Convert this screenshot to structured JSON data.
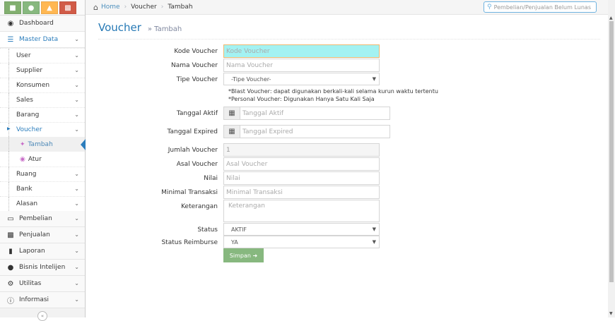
{
  "shortcuts": [
    {
      "icon": "stats-icon",
      "color": "#82af6f"
    },
    {
      "icon": "users-icon",
      "color": "#87b87f"
    },
    {
      "icon": "basket-icon",
      "color": "#ffb752"
    },
    {
      "icon": "money-icon",
      "color": "#d15b47"
    }
  ],
  "sidebar": {
    "dashboard": "Dashboard",
    "master_data": "Master Data",
    "sub": [
      "User",
      "Supplier",
      "Konsumen",
      "Sales",
      "Barang",
      "Voucher"
    ],
    "voucher_children": [
      "Tambah",
      "Atur"
    ],
    "sub2": [
      "Ruang",
      "Bank",
      "Alasan"
    ],
    "bottom": [
      "Pembelian",
      "Penjualan",
      "Laporan",
      "Bisnis Intelijen",
      "Utilitas",
      "Informasi"
    ]
  },
  "breadcrumb": {
    "home": "Home",
    "level1": "Voucher",
    "level2": "Tambah"
  },
  "search": {
    "placeholder": "Pembelian/Penjualan Belum Lunas"
  },
  "header": {
    "title": "Voucher",
    "subtitle": "» Tambah"
  },
  "form": {
    "kode_label": "Kode Voucher",
    "kode_placeholder": "Kode Voucher",
    "nama_label": "Nama Voucher",
    "nama_placeholder": "Nama Voucher",
    "tipe_label": "Tipe Voucher",
    "tipe_value": "-Tipe Voucher-",
    "note1": "*Blast Voucher: dapat digunakan berkali-kali selama kurun waktu tertentu",
    "note2": "*Personal Voucher: Digunakan Hanya Satu Kali Saja",
    "aktif_label": "Tanggal Aktif",
    "aktif_placeholder": "Tanggal Aktif",
    "expired_label": "Tanggal Expired",
    "expired_placeholder": "Tanggal Expired",
    "jumlah_label": "Jumlah Voucher",
    "jumlah_value": "1",
    "asal_label": "Asal Voucher",
    "asal_placeholder": "Asal Voucher",
    "nilai_label": "Nilai",
    "nilai_placeholder": "Nilai",
    "minimal_label": "Minimal Transaksi",
    "minimal_placeholder": "Minimal Transaksi",
    "ket_label": "Keterangan",
    "ket_placeholder": "Keterangan",
    "status_label": "Status",
    "status_value": "AKTIF",
    "reimburse_label": "Status Reimburse",
    "reimburse_value": "YA",
    "submit": "Simpan"
  }
}
